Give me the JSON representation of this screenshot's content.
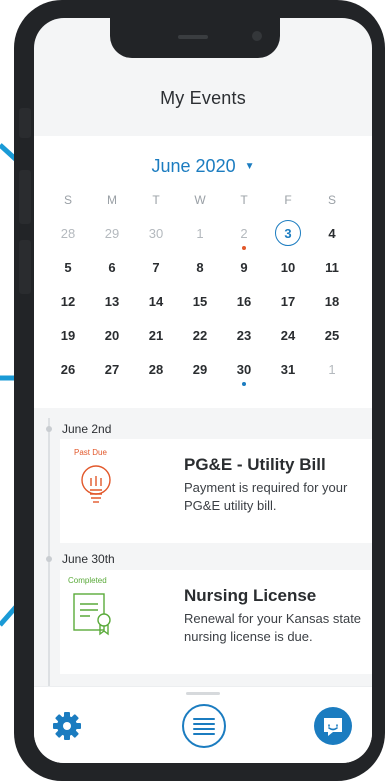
{
  "header": {
    "title": "My Events"
  },
  "calendar": {
    "month": "June",
    "year": "2020",
    "weekdays": [
      "S",
      "M",
      "T",
      "W",
      "T",
      "F",
      "S"
    ],
    "weeks": [
      [
        "28",
        "29",
        "30",
        "1",
        "2",
        "3",
        "4"
      ],
      [
        "5",
        "6",
        "7",
        "8",
        "9",
        "10",
        "11"
      ],
      [
        "12",
        "13",
        "14",
        "15",
        "16",
        "17",
        "18"
      ],
      [
        "19",
        "20",
        "21",
        "22",
        "23",
        "24",
        "25"
      ],
      [
        "26",
        "27",
        "28",
        "29",
        "30",
        "31",
        "1"
      ]
    ],
    "selected_day": "3"
  },
  "events": [
    {
      "date": "June 2nd",
      "status": "Past Due",
      "title": "PG&E - Utility Bill",
      "description": "Payment is required for your PG&E utility bill.",
      "icon": "lightbulb-icon"
    },
    {
      "date": "June 30th",
      "status": "Completed",
      "title": "Nursing License",
      "description": "Renewal for your Kansas state nursing license is due.",
      "icon": "certificate-icon"
    }
  ],
  "toolbar": {
    "left_icon": "gear-icon",
    "center_icon": "menu-icon",
    "right_icon": "chat-icon"
  },
  "colors": {
    "accent": "#1b7cc0",
    "past_due": "#e2582b",
    "completed": "#5aaa3a",
    "bg_lines": "#1a9ad6"
  }
}
